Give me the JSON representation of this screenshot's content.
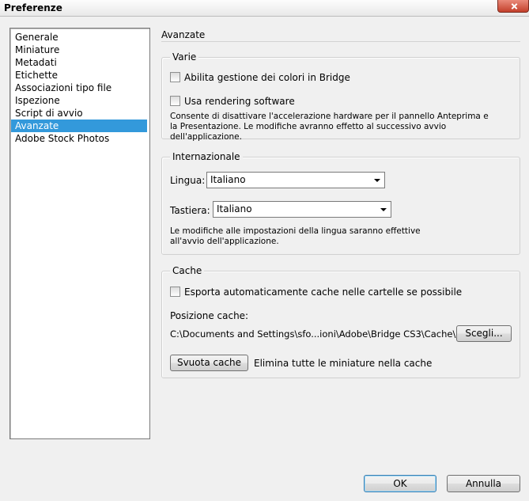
{
  "window": {
    "title": "Preferenze"
  },
  "sidebar": {
    "items": [
      {
        "label": "Generale",
        "selected": false
      },
      {
        "label": "Miniature",
        "selected": false
      },
      {
        "label": "Metadati",
        "selected": false
      },
      {
        "label": "Etichette",
        "selected": false
      },
      {
        "label": "Associazioni tipo file",
        "selected": false
      },
      {
        "label": "Ispezione",
        "selected": false
      },
      {
        "label": "Script di avvio",
        "selected": false
      },
      {
        "label": "Avanzate",
        "selected": true
      },
      {
        "label": "Adobe Stock Photos",
        "selected": false
      }
    ]
  },
  "main": {
    "section_title": "Avanzate",
    "varie": {
      "label": "Varie",
      "color_mgmt": {
        "label": "Abilita gestione dei colori in Bridge",
        "checked": false
      },
      "software_render": {
        "label": "Usa rendering software",
        "checked": false
      },
      "note": "Consente di disattivare l'accelerazione hardware per il pannello Anteprima e la Presentazione. Le modifiche avranno effetto al successivo avvio dell'applicazione."
    },
    "internazionale": {
      "label": "Internazionale",
      "lingua_label": "Lingua:",
      "lingua_value": "Italiano",
      "tastiera_label": "Tastiera:",
      "tastiera_value": "Italiano",
      "note": "Le modifiche alle impostazioni della lingua saranno effettive all'avvio dell'applicazione."
    },
    "cache": {
      "label": "Cache",
      "export": {
        "label": "Esporta automaticamente cache nelle cartelle se possibile",
        "checked": false
      },
      "position_label": "Posizione cache:",
      "path": "C:\\Documents and Settings\\sfo...ioni\\Adobe\\Bridge CS3\\Cache\\",
      "choose_button": "Scegli...",
      "purge_button": "Svuota cache",
      "purge_desc": "Elimina tutte le miniature nella cache"
    }
  },
  "footer": {
    "ok_label": "OK",
    "cancel_label": "Annulla"
  }
}
